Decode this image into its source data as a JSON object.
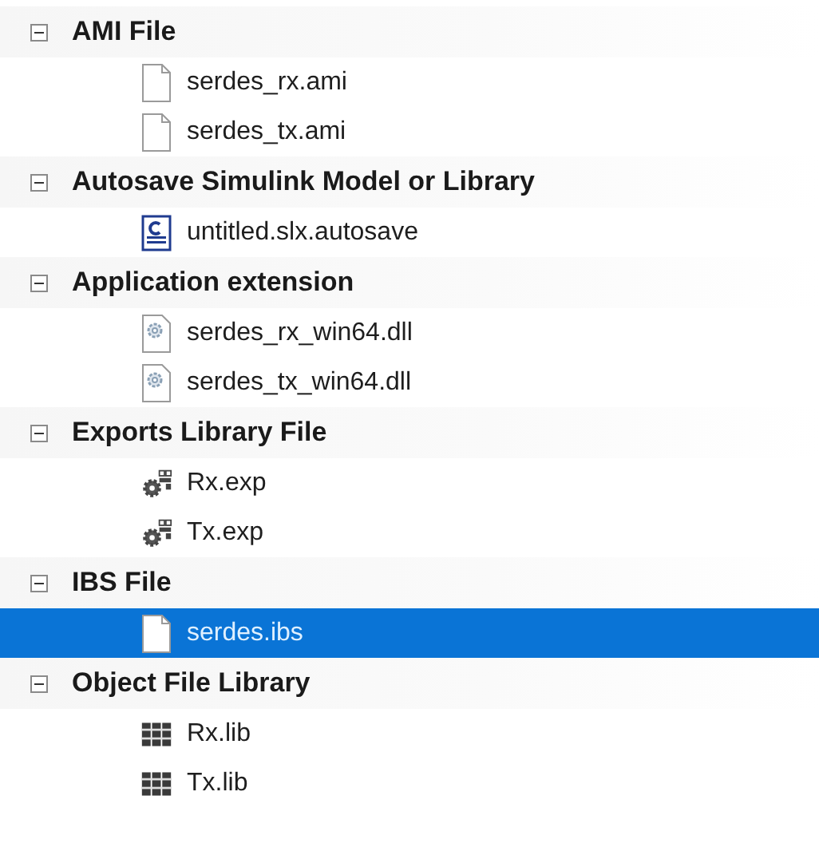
{
  "groups": [
    {
      "label": "AMI File",
      "expanded": true,
      "children": [
        {
          "label": "serdes_rx.ami",
          "kind": "blank",
          "selected": false
        },
        {
          "label": "serdes_tx.ami",
          "kind": "blank",
          "selected": false
        }
      ]
    },
    {
      "label": "Autosave Simulink Model or Library",
      "expanded": true,
      "children": [
        {
          "label": "untitled.slx.autosave",
          "kind": "script",
          "selected": false
        }
      ]
    },
    {
      "label": "Application extension",
      "expanded": true,
      "children": [
        {
          "label": "serdes_rx_win64.dll",
          "kind": "extension",
          "selected": false
        },
        {
          "label": "serdes_tx_win64.dll",
          "kind": "extension",
          "selected": false
        }
      ]
    },
    {
      "label": "Exports Library File",
      "expanded": true,
      "children": [
        {
          "label": "Rx.exp",
          "kind": "exports",
          "selected": false
        },
        {
          "label": "Tx.exp",
          "kind": "exports",
          "selected": false
        }
      ]
    },
    {
      "label": "IBS File",
      "expanded": true,
      "children": [
        {
          "label": "serdes.ibs",
          "kind": "blank",
          "selected": true
        }
      ]
    },
    {
      "label": "Object File Library",
      "expanded": true,
      "children": [
        {
          "label": "Rx.lib",
          "kind": "library",
          "selected": false
        },
        {
          "label": "Tx.lib",
          "kind": "library",
          "selected": false
        }
      ]
    }
  ]
}
